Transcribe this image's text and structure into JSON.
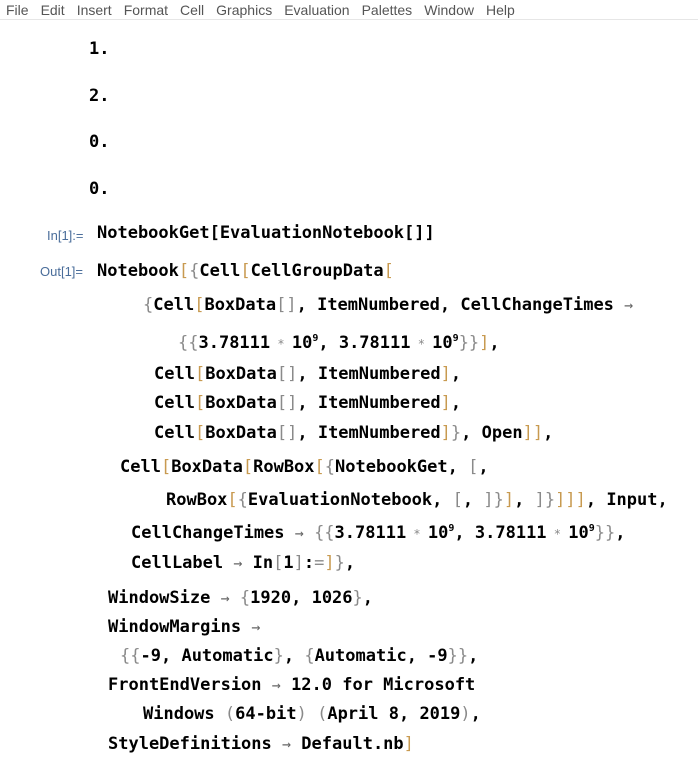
{
  "menubar": {
    "items": [
      "File",
      "Edit",
      "Insert",
      "Format",
      "Cell",
      "Graphics",
      "Evaluation",
      "Palettes",
      "Window",
      "Help"
    ]
  },
  "numbered_items": [
    "1.",
    "2.",
    "0.",
    "0."
  ],
  "input_cell": {
    "label": "In[1]:=",
    "code": "NotebookGet[EvaluationNotebook[]]"
  },
  "output_cell": {
    "label": "Out[1]=",
    "lines": [
      "Notebook[{Cell[CellGroupData[",
      "{Cell[BoxData[], ItemNumbered, CellChangeTimes →",
      "{{3.78111*10^9, 3.78111*10^9}}],",
      "Cell[BoxData[], ItemNumbered],",
      "Cell[BoxData[], ItemNumbered],",
      "Cell[BoxData[], ItemNumbered]}, Open]],",
      "Cell[BoxData[RowBox[{NotebookGet, [,",
      "RowBox[{EvaluationNotebook, [, ]}], ]}]], Input,",
      "CellChangeTimes → {{3.78111*10^9, 3.78111*10^9}},",
      "CellLabel → In[1]:=]},",
      "WindowSize → {1920, 1026},",
      "WindowMargins →",
      "{{-9, Automatic}, {Automatic, -9}},",
      "FrontEndVersion → 12.0 for Microsoft",
      "Windows (64-bit) (April 8, 2019),",
      "StyleDefinitions → Default.nb]"
    ],
    "tokens": {
      "Notebook": "Notebook",
      "Cell": "Cell",
      "CellGroupData": "CellGroupData",
      "BoxData": "BoxData",
      "ItemNumbered": "ItemNumbered",
      "CellChangeTimes": "CellChangeTimes",
      "mantissa": "3.78111",
      "base": "10",
      "exponent": "9",
      "Open": "Open",
      "RowBox": "RowBox",
      "NotebookGet": "NotebookGet",
      "EvaluationNotebook": "EvaluationNotebook",
      "Input": "Input",
      "CellLabel": "CellLabel",
      "In": "In",
      "one": "1",
      "WindowSize": "WindowSize",
      "ws_w": "1920",
      "ws_h": "1026",
      "WindowMargins": "WindowMargins",
      "neg9": "-9",
      "Automatic": "Automatic",
      "FrontEndVersion": "FrontEndVersion",
      "fev1": "12.0 for Microsoft",
      "fev_windows": "Windows",
      "fev_bits": "64-bit",
      "fev_date": "April 8, 2019",
      "StyleDefinitions": "StyleDefinitions",
      "DefaultNb": "Default.nb"
    }
  }
}
